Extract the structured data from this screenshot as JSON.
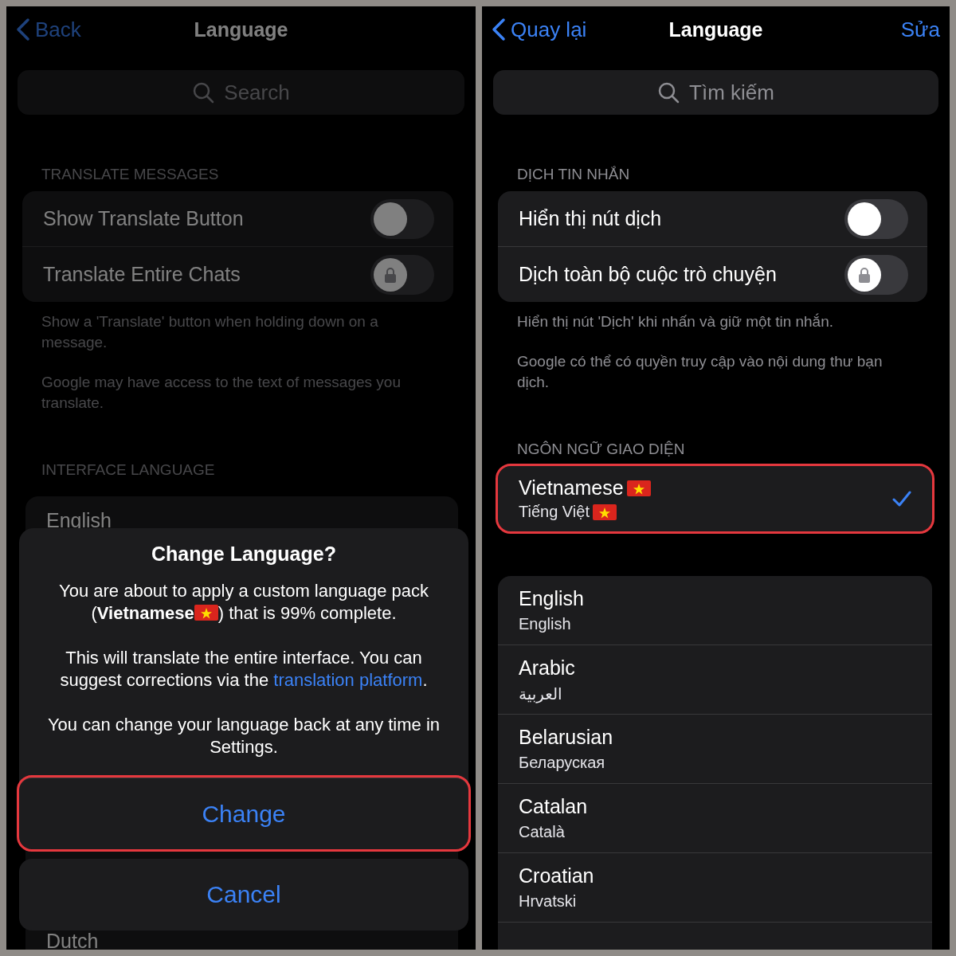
{
  "left_screen": {
    "dimmed": true,
    "nav": {
      "back": "Back",
      "title": "Language"
    },
    "search": {
      "placeholder": "Search"
    },
    "translate_section": {
      "header": "TRANSLATE MESSAGES",
      "toggles": [
        {
          "label": "Show Translate Button",
          "on": false,
          "locked": false
        },
        {
          "label": "Translate Entire Chats",
          "on": false,
          "locked": true
        }
      ],
      "footnotes": [
        "Show a 'Translate' button when holding down on a message.",
        "Google may have access to the text of messages you translate."
      ]
    },
    "interface_section": {
      "header": "INTERFACE LANGUAGE"
    },
    "languages": [
      {
        "name": "English"
      },
      {
        "name": "Dutch"
      }
    ],
    "dialog": {
      "title": "Change Language?",
      "paragraphs": [
        {
          "before": "You are about to apply a custom language pack (**Vietnamese**",
          "flag": true,
          "after": ") that is 99% complete."
        },
        {
          "before": "This will translate the entire interface. You can suggest corrections via the ",
          "link": "translation platform",
          "after": "."
        },
        {
          "before": "You can change your language back at any time in Settings."
        }
      ],
      "buttons": [
        {
          "label": "Change",
          "highlighted": true
        },
        {
          "label": "Cancel",
          "highlighted": false
        }
      ]
    }
  },
  "right_screen": {
    "dimmed": false,
    "nav": {
      "back": "Quay lại",
      "title": "Language",
      "action": "Sửa"
    },
    "search": {
      "placeholder": "Tìm kiếm"
    },
    "translate_section": {
      "header": "DỊCH TIN NHẮN",
      "toggles": [
        {
          "label": "Hiển thị nút dịch",
          "on": false,
          "locked": false
        },
        {
          "label": "Dịch toàn bộ cuộc trò chuyện",
          "on": false,
          "locked": true
        }
      ],
      "footnotes": [
        "Hiển thị nút 'Dịch' khi nhấn và giữ một tin nhắn.",
        "Google có thể có quyền truy cập vào nội dung thư bạn dịch."
      ]
    },
    "interface_section": {
      "header": "NGÔN NGỮ GIAO DIỆN"
    },
    "current_language": {
      "name": "Vietnamese",
      "native": "Tiếng Việt",
      "flag": true,
      "selected": true,
      "highlighted": true
    },
    "languages": [
      {
        "name": "English",
        "native": "English",
        "selected": false
      },
      {
        "name": "Arabic",
        "native": "العربية",
        "selected": false
      },
      {
        "name": "Belarusian",
        "native": "Беларуская",
        "selected": false
      },
      {
        "name": "Catalan",
        "native": "Català",
        "selected": false
      },
      {
        "name": "Croatian",
        "native": "Hrvatski",
        "selected": false
      }
    ]
  }
}
